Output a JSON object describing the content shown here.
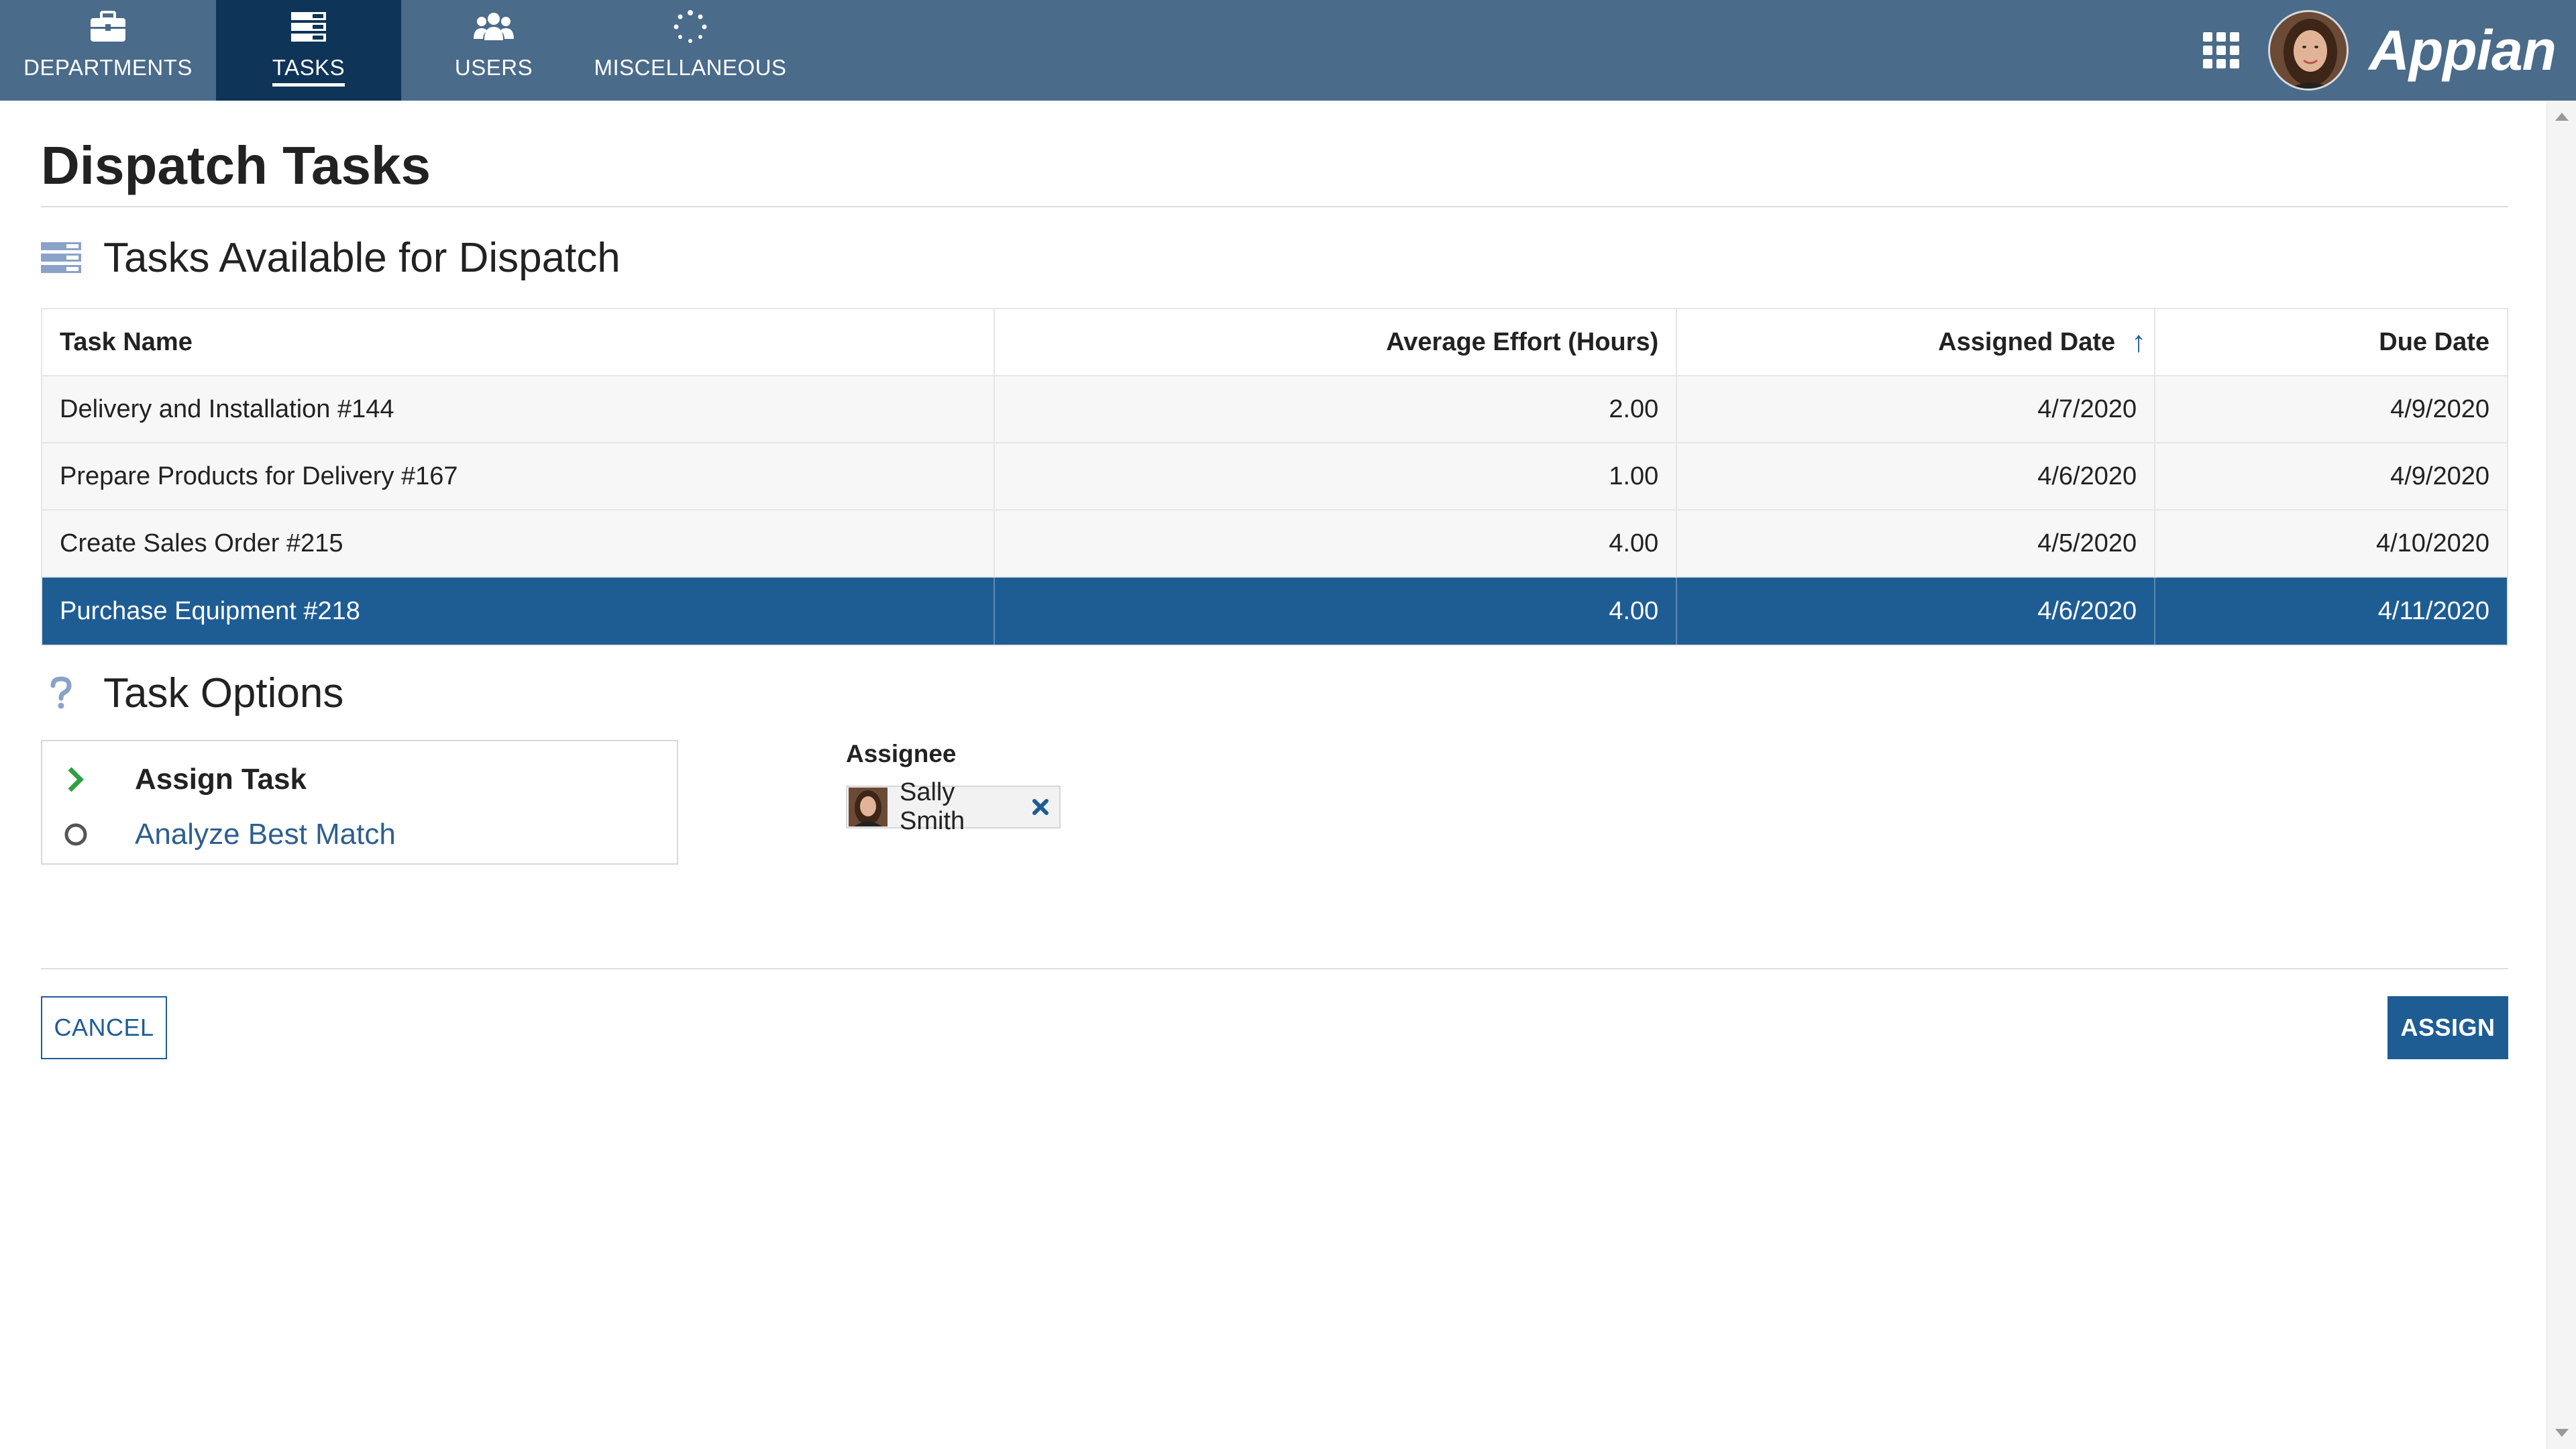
{
  "nav": {
    "tabs": [
      {
        "label": "DEPARTMENTS",
        "icon": "briefcase-icon"
      },
      {
        "label": "TASKS",
        "icon": "task-list-icon"
      },
      {
        "label": "USERS",
        "icon": "users-icon"
      },
      {
        "label": "MISCELLANEOUS",
        "icon": "spinner-icon"
      }
    ],
    "active_tab": "TASKS",
    "logo": "Appian",
    "apps_icon": "app-grid-icon"
  },
  "page": {
    "title": "Dispatch Tasks"
  },
  "tasks_section": {
    "heading": "Tasks Available for Dispatch",
    "icon": "task-list-icon",
    "columns": [
      "Task Name",
      "Average Effort (Hours)",
      "Assigned Date",
      "Due Date"
    ],
    "sort_column": "Assigned Date",
    "sort_direction": "ascending",
    "rows": [
      {
        "name": "Delivery and Installation #144",
        "effort": "2.00",
        "assigned": "4/7/2020",
        "due": "4/9/2020"
      },
      {
        "name": "Prepare Products for Delivery #167",
        "effort": "1.00",
        "assigned": "4/6/2020",
        "due": "4/9/2020"
      },
      {
        "name": "Create Sales Order #215",
        "effort": "4.00",
        "assigned": "4/5/2020",
        "due": "4/10/2020"
      },
      {
        "name": "Purchase Equipment #218",
        "effort": "4.00",
        "assigned": "4/6/2020",
        "due": "4/11/2020"
      }
    ],
    "selected_row": "Purchase Equipment #218"
  },
  "options_section": {
    "heading": "Task Options",
    "icon": "help-icon",
    "options": [
      {
        "label": "Assign Task",
        "state": "active"
      },
      {
        "label": "Analyze Best Match",
        "state": "inactive"
      }
    ]
  },
  "assignee": {
    "label": "Assignee",
    "user": "Sally Smith"
  },
  "actions": {
    "cancel": "CANCEL",
    "assign": "ASSIGN"
  },
  "colors": {
    "nav_bg": "#4a6b8a",
    "nav_active": "#0e3457",
    "accent": "#1e5d94",
    "option_active_chevron": "#2ea043"
  }
}
